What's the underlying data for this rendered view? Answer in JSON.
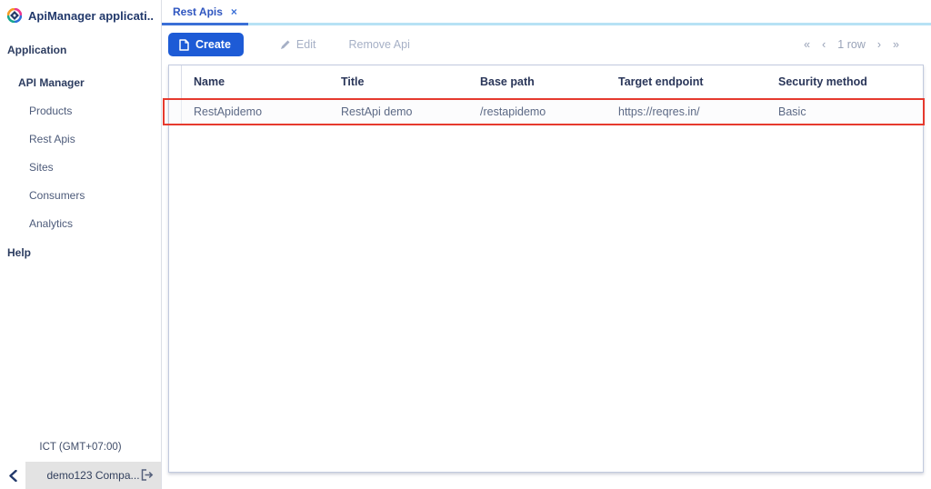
{
  "colors": {
    "accent_blue": "#1d5bd6",
    "tab_underline": "#3a6fd7",
    "tabbar_underline": "#b7e2f5",
    "annotation_red": "#e63a2e"
  },
  "sidebar": {
    "title": "ApiManager applicati...",
    "application_label": "Application",
    "api_manager_label": "API Manager",
    "items": [
      "Products",
      "Rest Apis",
      "Sites",
      "Consumers",
      "Analytics"
    ],
    "help_label": "Help",
    "timezone": "ICT (GMT+07:00)",
    "footer": {
      "account": "demo123 Compa..."
    }
  },
  "tabs": [
    {
      "label": "Rest Apis",
      "close": "×",
      "active": true
    }
  ],
  "toolbar": {
    "create_label": "Create",
    "edit_label": "Edit",
    "remove_label": "Remove Api"
  },
  "pagination": {
    "first": "«",
    "prev": "‹",
    "status": "1 row",
    "next": "›",
    "last": "»"
  },
  "table": {
    "columns": [
      "Name",
      "Title",
      "Base path",
      "Target endpoint",
      "Security method"
    ],
    "rows": [
      {
        "cells": [
          "RestApidemo",
          "RestApi demo",
          "/restapidemo",
          "https://reqres.in/",
          "Basic"
        ]
      }
    ]
  }
}
